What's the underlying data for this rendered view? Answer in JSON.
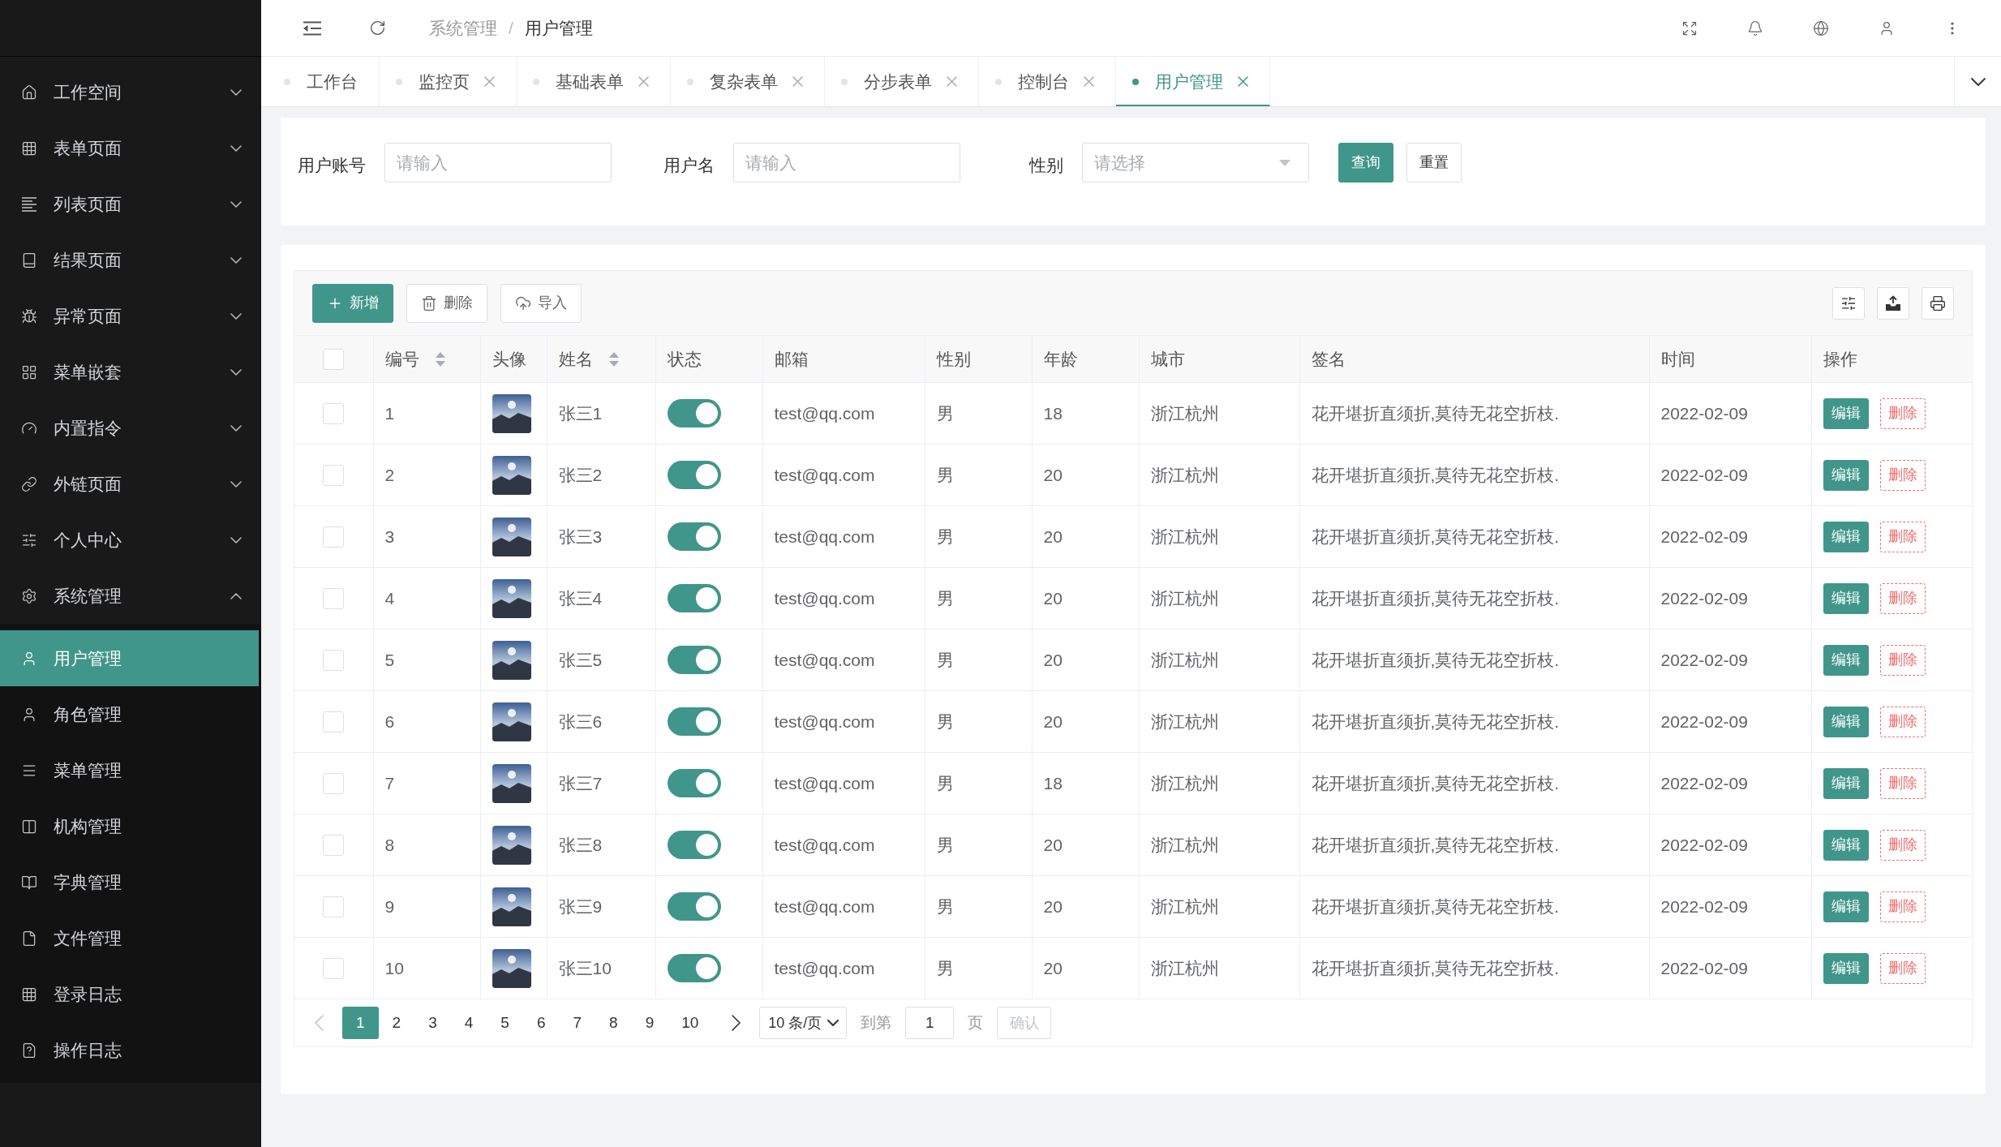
{
  "sidebar": {
    "items": [
      {
        "label": "工作空间",
        "expanded": false
      },
      {
        "label": "表单页面",
        "expanded": false
      },
      {
        "label": "列表页面",
        "expanded": false
      },
      {
        "label": "结果页面",
        "expanded": false
      },
      {
        "label": "异常页面",
        "expanded": false
      },
      {
        "label": "菜单嵌套",
        "expanded": false
      },
      {
        "label": "内置指令",
        "expanded": false
      },
      {
        "label": "外链页面",
        "expanded": false
      },
      {
        "label": "个人中心",
        "expanded": false
      },
      {
        "label": "系统管理",
        "expanded": true,
        "children": [
          {
            "label": "用户管理",
            "selected": true
          },
          {
            "label": "角色管理",
            "selected": false
          },
          {
            "label": "菜单管理",
            "selected": false
          },
          {
            "label": "机构管理",
            "selected": false
          },
          {
            "label": "字典管理",
            "selected": false
          },
          {
            "label": "文件管理",
            "selected": false
          },
          {
            "label": "登录日志",
            "selected": false
          },
          {
            "label": "操作日志",
            "selected": false
          }
        ]
      }
    ]
  },
  "header": {
    "breadcrumb": [
      {
        "label": "系统管理",
        "current": false
      },
      {
        "label": "用户管理",
        "current": true
      }
    ],
    "separator": "/"
  },
  "tabs": [
    {
      "label": "工作台",
      "selected": false,
      "closable": false
    },
    {
      "label": "监控页",
      "selected": false,
      "closable": true
    },
    {
      "label": "基础表单",
      "selected": false,
      "closable": true
    },
    {
      "label": "复杂表单",
      "selected": false,
      "closable": true
    },
    {
      "label": "分步表单",
      "selected": false,
      "closable": true
    },
    {
      "label": "控制台",
      "selected": false,
      "closable": true
    },
    {
      "label": "用户管理",
      "selected": true,
      "closable": true
    }
  ],
  "search_form": {
    "fields": [
      {
        "kind": "input",
        "label": "用户账号",
        "placeholder": "请输入"
      },
      {
        "kind": "input",
        "label": "用户名",
        "placeholder": "请输入"
      },
      {
        "kind": "select",
        "label": "性别",
        "placeholder": "请选择"
      }
    ],
    "buttons": [
      {
        "label": "查询",
        "kind": "primary"
      },
      {
        "label": "重置",
        "kind": "default"
      }
    ]
  },
  "toolbar": {
    "buttons": [
      {
        "label": "新增",
        "kind": "primary"
      },
      {
        "label": "删除",
        "kind": "default"
      },
      {
        "label": "导入",
        "kind": "default"
      }
    ]
  },
  "table": {
    "header_checkbox": {
      "checked": false
    },
    "columns": [
      {
        "label": "编号",
        "sortable": true
      },
      {
        "label": "头像",
        "sortable": false
      },
      {
        "label": "姓名",
        "sortable": true
      },
      {
        "label": "状态",
        "sortable": false
      },
      {
        "label": "邮箱",
        "sortable": false
      },
      {
        "label": "性别",
        "sortable": false
      },
      {
        "label": "年龄",
        "sortable": false
      },
      {
        "label": "城市",
        "sortable": false
      },
      {
        "label": "签名",
        "sortable": false
      },
      {
        "label": "时间",
        "sortable": false
      },
      {
        "label": "操作",
        "sortable": false
      }
    ],
    "rows": [
      {
        "checked": false,
        "id": "1",
        "name": "张三1",
        "on": true,
        "email": "test@qq.com",
        "gender": "男",
        "age": "18",
        "city": "浙江杭州",
        "signature": "花开堪折直须折,莫待无花空折枝.",
        "time": "2022-02-09",
        "actions": [
          {
            "label": "编辑",
            "kind": "edit"
          },
          {
            "label": "删除",
            "kind": "delete"
          }
        ]
      },
      {
        "checked": false,
        "id": "2",
        "name": "张三2",
        "on": true,
        "email": "test@qq.com",
        "gender": "男",
        "age": "20",
        "city": "浙江杭州",
        "signature": "花开堪折直须折,莫待无花空折枝.",
        "time": "2022-02-09",
        "actions": [
          {
            "label": "编辑",
            "kind": "edit"
          },
          {
            "label": "删除",
            "kind": "delete"
          }
        ]
      },
      {
        "checked": false,
        "id": "3",
        "name": "张三3",
        "on": true,
        "email": "test@qq.com",
        "gender": "男",
        "age": "20",
        "city": "浙江杭州",
        "signature": "花开堪折直须折,莫待无花空折枝.",
        "time": "2022-02-09",
        "actions": [
          {
            "label": "编辑",
            "kind": "edit"
          },
          {
            "label": "删除",
            "kind": "delete"
          }
        ]
      },
      {
        "checked": false,
        "id": "4",
        "name": "张三4",
        "on": true,
        "email": "test@qq.com",
        "gender": "男",
        "age": "20",
        "city": "浙江杭州",
        "signature": "花开堪折直须折,莫待无花空折枝.",
        "time": "2022-02-09",
        "actions": [
          {
            "label": "编辑",
            "kind": "edit"
          },
          {
            "label": "删除",
            "kind": "delete"
          }
        ]
      },
      {
        "checked": false,
        "id": "5",
        "name": "张三5",
        "on": true,
        "email": "test@qq.com",
        "gender": "男",
        "age": "20",
        "city": "浙江杭州",
        "signature": "花开堪折直须折,莫待无花空折枝.",
        "time": "2022-02-09",
        "actions": [
          {
            "label": "编辑",
            "kind": "edit"
          },
          {
            "label": "删除",
            "kind": "delete"
          }
        ]
      },
      {
        "checked": false,
        "id": "6",
        "name": "张三6",
        "on": true,
        "email": "test@qq.com",
        "gender": "男",
        "age": "20",
        "city": "浙江杭州",
        "signature": "花开堪折直须折,莫待无花空折枝.",
        "time": "2022-02-09",
        "actions": [
          {
            "label": "编辑",
            "kind": "edit"
          },
          {
            "label": "删除",
            "kind": "delete"
          }
        ]
      },
      {
        "checked": false,
        "id": "7",
        "name": "张三7",
        "on": true,
        "email": "test@qq.com",
        "gender": "男",
        "age": "18",
        "city": "浙江杭州",
        "signature": "花开堪折直须折,莫待无花空折枝.",
        "time": "2022-02-09",
        "actions": [
          {
            "label": "编辑",
            "kind": "edit"
          },
          {
            "label": "删除",
            "kind": "delete"
          }
        ]
      },
      {
        "checked": false,
        "id": "8",
        "name": "张三8",
        "on": true,
        "email": "test@qq.com",
        "gender": "男",
        "age": "20",
        "city": "浙江杭州",
        "signature": "花开堪折直须折,莫待无花空折枝.",
        "time": "2022-02-09",
        "actions": [
          {
            "label": "编辑",
            "kind": "edit"
          },
          {
            "label": "删除",
            "kind": "delete"
          }
        ]
      },
      {
        "checked": false,
        "id": "9",
        "name": "张三9",
        "on": true,
        "email": "test@qq.com",
        "gender": "男",
        "age": "20",
        "city": "浙江杭州",
        "signature": "花开堪折直须折,莫待无花空折枝.",
        "time": "2022-02-09",
        "actions": [
          {
            "label": "编辑",
            "kind": "edit"
          },
          {
            "label": "删除",
            "kind": "delete"
          }
        ]
      },
      {
        "checked": false,
        "id": "10",
        "name": "张三10",
        "on": true,
        "email": "test@qq.com",
        "gender": "男",
        "age": "20",
        "city": "浙江杭州",
        "signature": "花开堪折直须折,莫待无花空折枝.",
        "time": "2022-02-09",
        "actions": [
          {
            "label": "编辑",
            "kind": "edit"
          },
          {
            "label": "删除",
            "kind": "delete"
          }
        ]
      }
    ]
  },
  "pagination": {
    "prev_disabled": true,
    "pages": [
      {
        "label": "1",
        "selected": true
      },
      {
        "label": "2",
        "selected": false
      },
      {
        "label": "3",
        "selected": false
      },
      {
        "label": "4",
        "selected": false
      },
      {
        "label": "5",
        "selected": false
      },
      {
        "label": "6",
        "selected": false
      },
      {
        "label": "7",
        "selected": false
      },
      {
        "label": "8",
        "selected": false
      },
      {
        "label": "9",
        "selected": false
      },
      {
        "label": "10",
        "selected": false
      }
    ],
    "next_disabled": false,
    "page_size": "10 条/页",
    "goto_label": "到第",
    "goto_value": "1",
    "page_unit": "页",
    "confirm": {
      "label": "确认",
      "disabled": true
    }
  }
}
